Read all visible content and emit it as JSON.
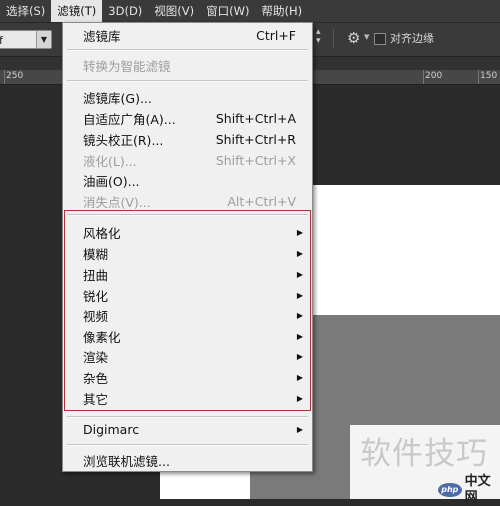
{
  "menubar": {
    "items": [
      "选择(S)",
      "滤镜(T)",
      "3D(D)",
      "视图(V)",
      "窗口(W)",
      "帮助(H)"
    ]
  },
  "options": {
    "mode_value": "f",
    "align_edges_label": "对齐边缘"
  },
  "ruler": {
    "ticks": [
      "250",
      "200",
      "150"
    ]
  },
  "filter_menu": {
    "last_filter": {
      "label": "滤镜库",
      "shortcut": "Ctrl+F"
    },
    "convert_smart": "转换为智能滤镜",
    "group_a": [
      {
        "label": "滤镜库(G)...",
        "shortcut": ""
      },
      {
        "label": "自适应广角(A)...",
        "shortcut": "Shift+Ctrl+A"
      },
      {
        "label": "镜头校正(R)...",
        "shortcut": "Shift+Ctrl+R"
      },
      {
        "label": "液化(L)...",
        "shortcut": "Shift+Ctrl+X"
      },
      {
        "label": "油画(O)...",
        "shortcut": ""
      },
      {
        "label": "消失点(V)...",
        "shortcut": "Alt+Ctrl+V"
      }
    ],
    "submenus": [
      "风格化",
      "模糊",
      "扭曲",
      "锐化",
      "视频",
      "像素化",
      "渲染",
      "杂色",
      "其它"
    ],
    "digimarc": "Digimarc",
    "browse_online": "浏览联机滤镜..."
  },
  "watermark": {
    "text": "软件技巧",
    "logo": "php",
    "site": "中文网"
  }
}
